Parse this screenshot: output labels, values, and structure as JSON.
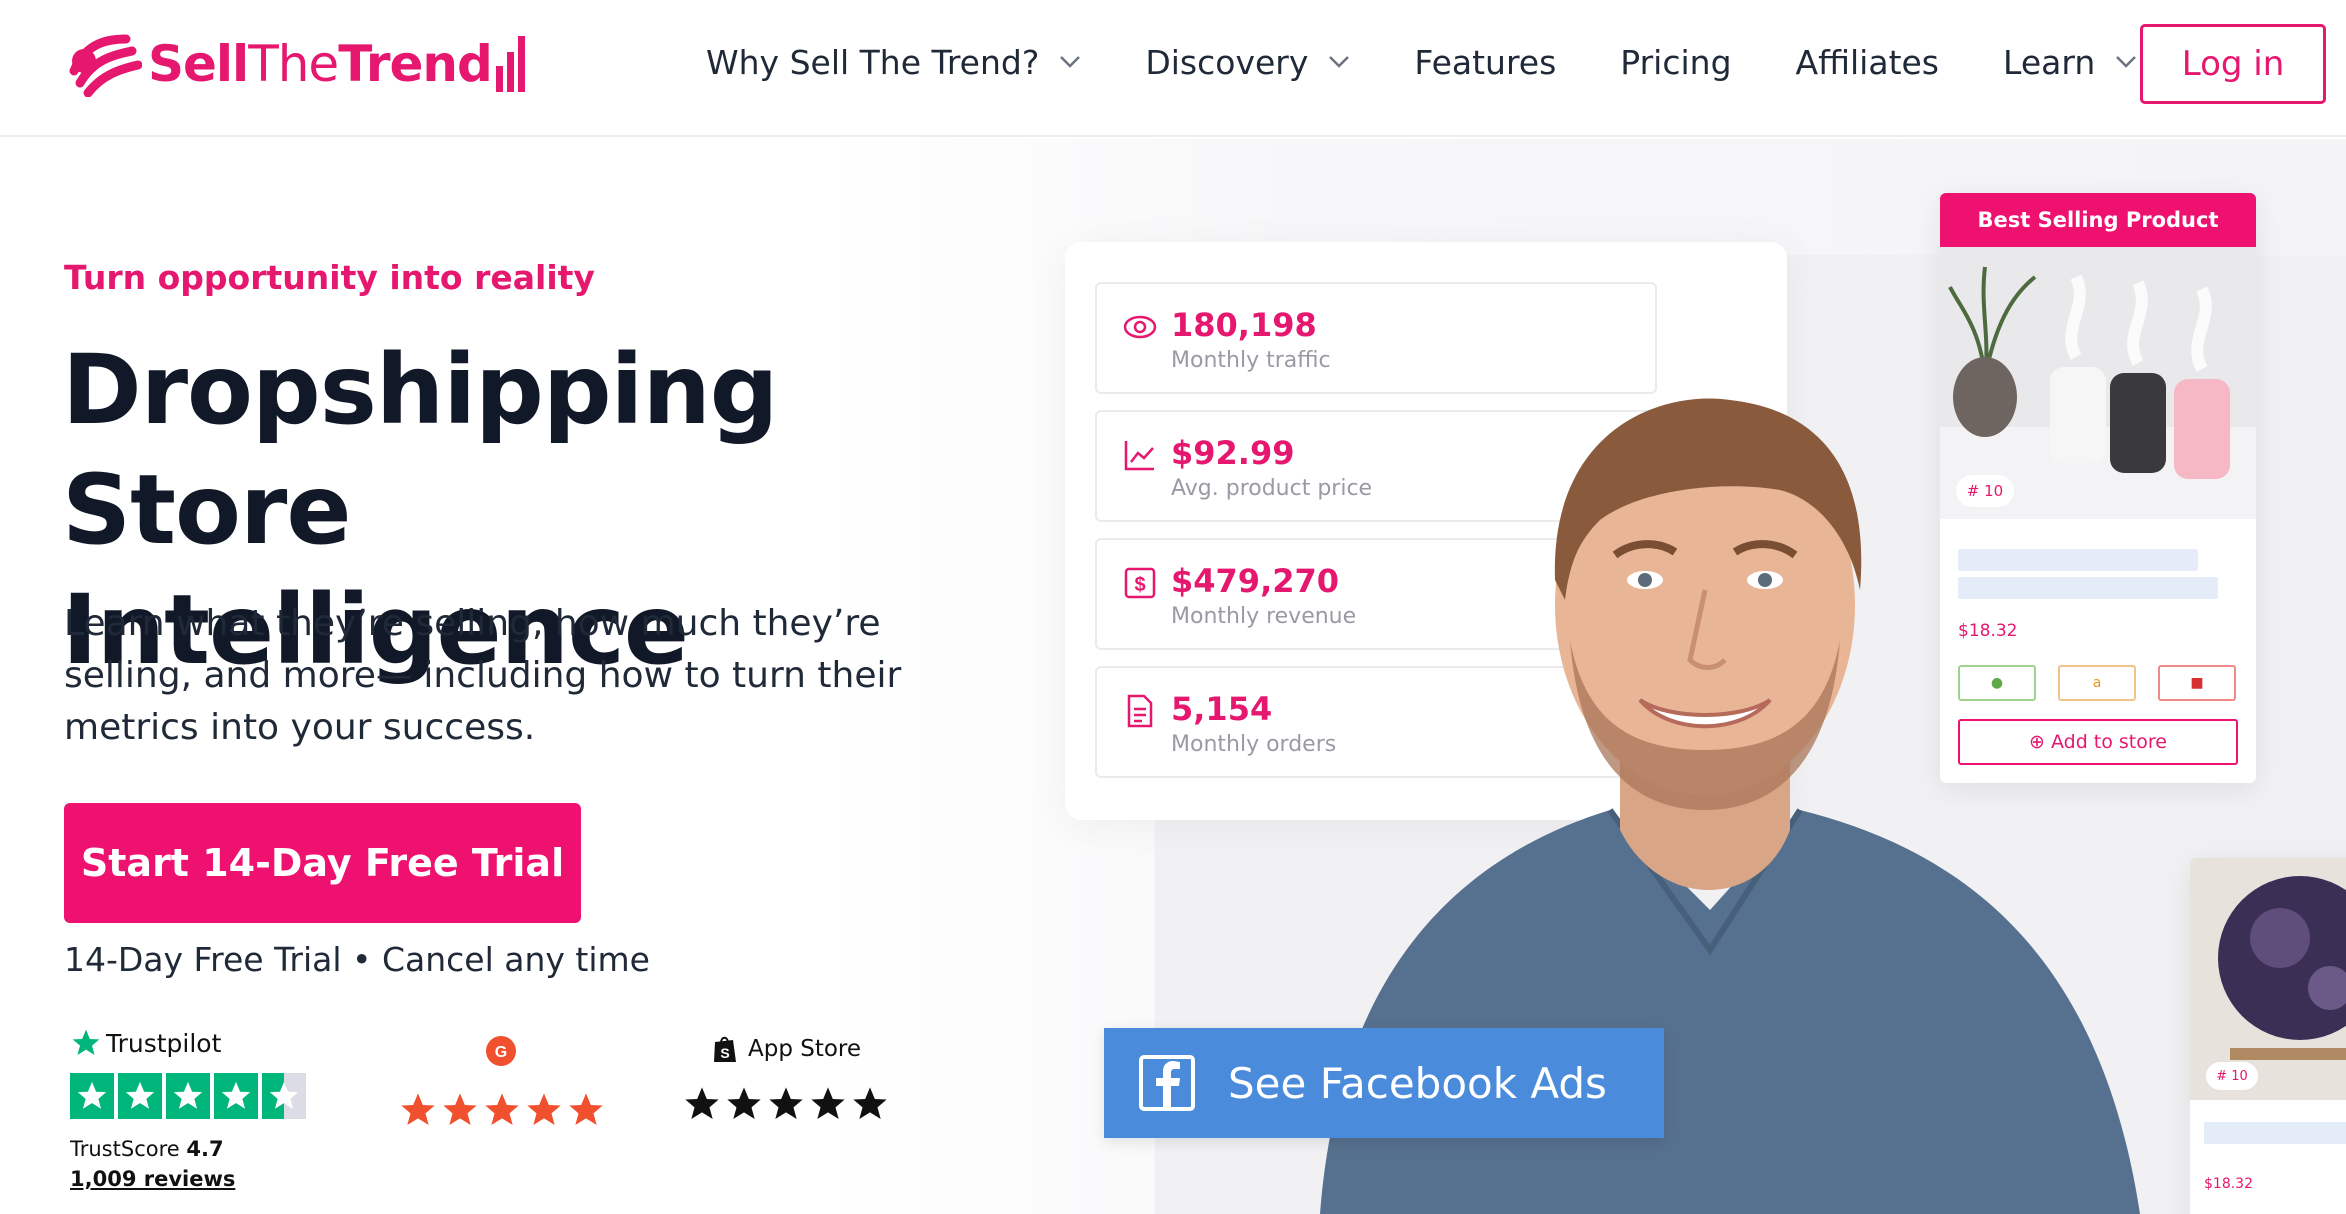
{
  "brand": {
    "part1": "Sell",
    "part2": "The",
    "part3": "Trend",
    "accent_color": "#e5176e"
  },
  "nav": {
    "items": [
      {
        "label": "Why Sell The Trend?",
        "has_dropdown": true
      },
      {
        "label": "Discovery",
        "has_dropdown": true
      },
      {
        "label": "Features",
        "has_dropdown": false
      },
      {
        "label": "Pricing",
        "has_dropdown": false
      },
      {
        "label": "Affiliates",
        "has_dropdown": false
      },
      {
        "label": "Learn",
        "has_dropdown": true
      }
    ],
    "login_label": "Log in"
  },
  "hero": {
    "eyebrow": "Turn opportunity into reality",
    "headline_line1": "Dropshipping",
    "headline_line2": "Store Intelligence",
    "subtext": "Learn what they’re selling, how much they’re selling, and more— including how to turn their metrics into your success.",
    "cta_label": "Start 14-Day Free Trial",
    "trial_note": "14-Day Free Trial • Cancel any time"
  },
  "ratings": {
    "trustpilot": {
      "name": "Trustpilot",
      "score_label": "TrustScore",
      "score": "4.7",
      "reviews": "1,009 reviews",
      "stars": 4.5
    },
    "g2": {
      "icon": "g2-icon",
      "stars": 5,
      "star_color": "#f0502e"
    },
    "app_store": {
      "name": "App Store",
      "icon": "shopify-bag-icon",
      "stars": 5
    }
  },
  "stats": [
    {
      "icon": "eye-icon",
      "value": "180,198",
      "label": "Monthly traffic"
    },
    {
      "icon": "chart-line-icon",
      "value": "$92.99",
      "label": "Avg. product price"
    },
    {
      "icon": "dollar-icon",
      "value": "$479,270",
      "label": "Monthly revenue"
    },
    {
      "icon": "document-icon",
      "value": "5,154",
      "label": "Monthly orders"
    }
  ],
  "best_selling": {
    "header": "Best Selling Product",
    "rank": "# 10",
    "price": "$18.32",
    "add_label": "⊕ Add to store"
  },
  "product2": {
    "rank": "# 10",
    "price": "$18.32"
  },
  "facebook": {
    "label": "See Facebook Ads",
    "color": "#4a8bdc"
  }
}
